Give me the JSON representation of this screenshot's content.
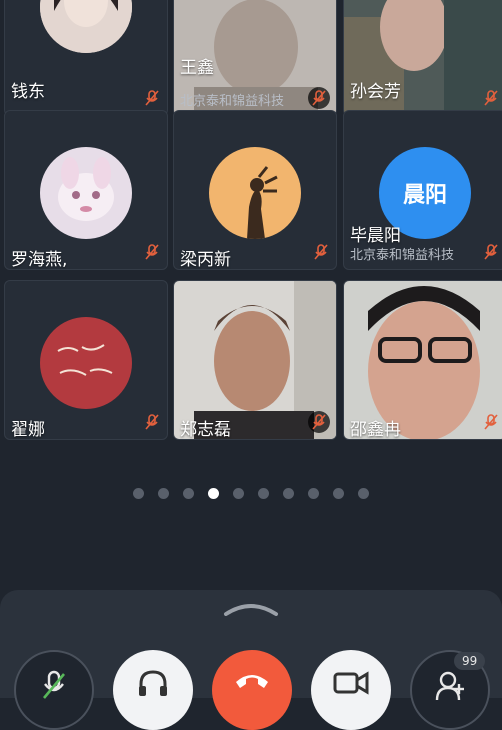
{
  "participants": [
    {
      "name": "钱东",
      "org": ""
    },
    {
      "name": "王鑫",
      "org": "北京泰和锦益科技"
    },
    {
      "name": "孙会芳",
      "org": ""
    },
    {
      "name": "罗海燕,",
      "org": ""
    },
    {
      "name": "梁丙新",
      "org": ""
    },
    {
      "name": "毕晨阳",
      "org": "北京泰和锦益科技",
      "avatar_text": "晨阳"
    },
    {
      "name": "翟娜",
      "org": ""
    },
    {
      "name": "郑志磊",
      "org": ""
    },
    {
      "name": "邵鑫冉",
      "org": ""
    }
  ],
  "pager": {
    "page_count": 10,
    "active_index": 3
  },
  "controls": {
    "participant_count": "99"
  },
  "colors": {
    "accent_blue": "#2e8ff0",
    "hangup_red": "#f25a3c",
    "background": "#1f252e"
  }
}
